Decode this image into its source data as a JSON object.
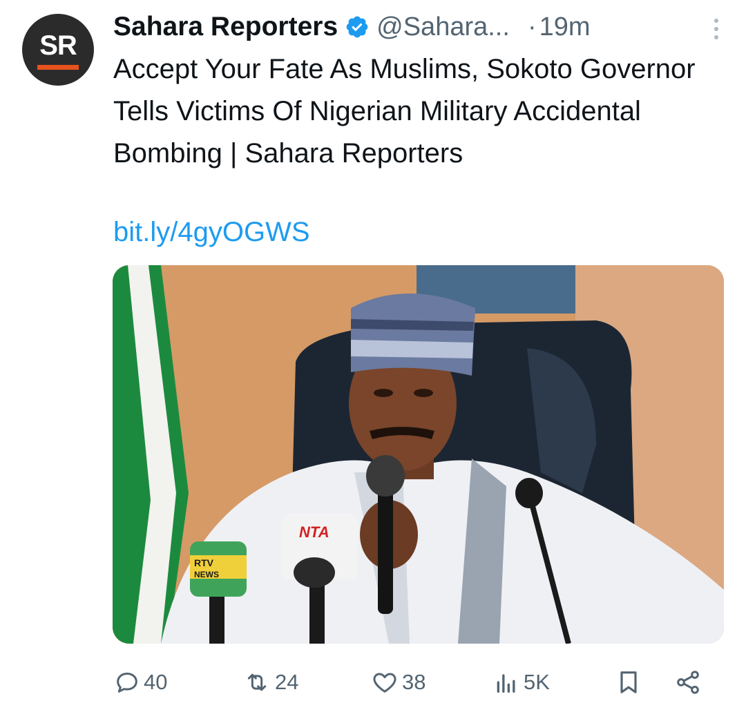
{
  "account": {
    "avatar_initials": "SR",
    "display_name": "Sahara Reporters",
    "verified_icon": "verified-badge-icon",
    "handle": "@Sahara...",
    "separator": "·",
    "time_ago": "19m"
  },
  "tweet": {
    "text": "Accept Your Fate As Muslims, Sokoto Governor Tells Victims Of Nigerian Military Accidental Bombing | Sahara Reporters",
    "link": "bit.ly/4gyOGWS"
  },
  "media": {
    "description_icon": "photo",
    "mic_labels": [
      "RTV NEWS",
      "NTA"
    ]
  },
  "actions": {
    "replies": "40",
    "reposts": "24",
    "likes": "38",
    "views": "5K"
  },
  "colors": {
    "link": "#1d9bf0",
    "verified": "#1d9bf0",
    "muted": "#536471",
    "brand_orange": "#e8531d"
  }
}
